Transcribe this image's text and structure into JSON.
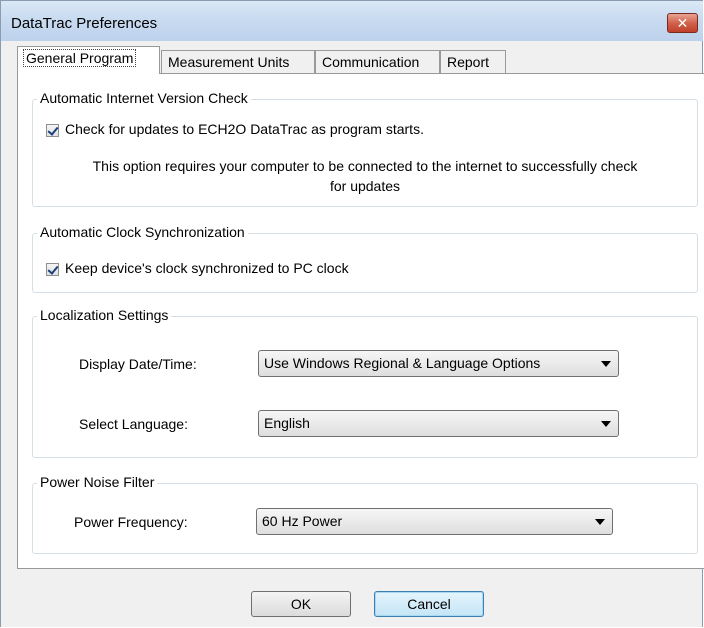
{
  "window": {
    "title": "DataTrac Preferences",
    "close_label": "✕"
  },
  "tabs": [
    {
      "label": "General Program",
      "active": true
    },
    {
      "label": "Measurement Units",
      "active": false
    },
    {
      "label": "Communication",
      "active": false
    },
    {
      "label": "Report",
      "active": false
    }
  ],
  "groups": {
    "version_check": {
      "title": "Automatic Internet Version Check",
      "checkbox_label": "Check for updates to ECH2O DataTrac as program starts.",
      "checked": true,
      "note_line1": "This option requires your computer to be connected to the internet to successfully check",
      "note_line2": "for updates"
    },
    "clock_sync": {
      "title": "Automatic Clock Synchronization",
      "checkbox_label": "Keep device's clock synchronized to PC clock",
      "checked": true
    },
    "localization": {
      "title": "Localization Settings",
      "date_time_label": "Display Date/Time:",
      "date_time_value": "Use Windows Regional & Language Options",
      "language_label": "Select Language:",
      "language_value": "English"
    },
    "power_noise": {
      "title": "Power Noise Filter",
      "frequency_label": "Power Frequency:",
      "frequency_value": "60 Hz Power"
    }
  },
  "buttons": {
    "ok": "OK",
    "cancel": "Cancel"
  },
  "colors": {
    "title_bar": "#c9dbf0",
    "close_button": "#c7503b",
    "default_button_border": "#3c7fb1"
  }
}
